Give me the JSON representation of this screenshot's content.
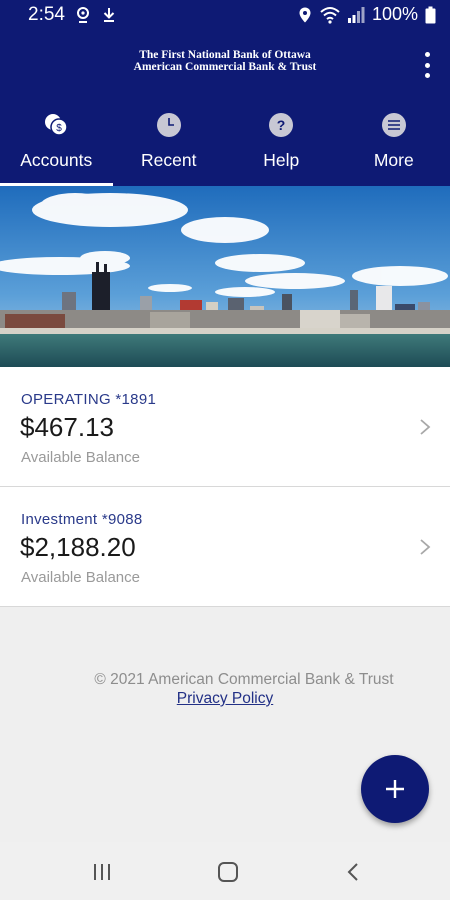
{
  "status": {
    "time": "2:54",
    "battery": "100%",
    "left_icons": [
      "location-icon",
      "download-icon"
    ],
    "right_icons": [
      "location-icon",
      "wifi-icon",
      "signal-icon",
      "battery-icon"
    ]
  },
  "header": {
    "bank_line1": "The First National Bank of Ottawa",
    "bank_line2": "American Commercial Bank & Trust",
    "menu_icon": "more-vert-icon"
  },
  "tabs": [
    {
      "label": "Accounts",
      "icon": "accounts-coins-icon",
      "active": true
    },
    {
      "label": "Recent",
      "icon": "clock-icon",
      "active": false
    },
    {
      "label": "Help",
      "icon": "help-icon",
      "active": false
    },
    {
      "label": "More",
      "icon": "menu-lines-icon",
      "active": false
    }
  ],
  "accounts": [
    {
      "name": "OPERATING *1891",
      "balance": "$467.13",
      "balance_label": "Available Balance"
    },
    {
      "name": "Investment *9088",
      "balance": "$2,188.20",
      "balance_label": "Available Balance"
    }
  ],
  "footer": {
    "copyright": "© 2021 American Commercial Bank & Trust",
    "privacy": "Privacy Policy"
  },
  "fab": {
    "icon": "plus-icon"
  },
  "navbar": {
    "icons": [
      "recent-apps-icon",
      "home-icon",
      "back-icon"
    ]
  },
  "colors": {
    "primary": "#0e1a74",
    "account_name": "#2a3a8a",
    "muted": "#9a9a9a"
  }
}
